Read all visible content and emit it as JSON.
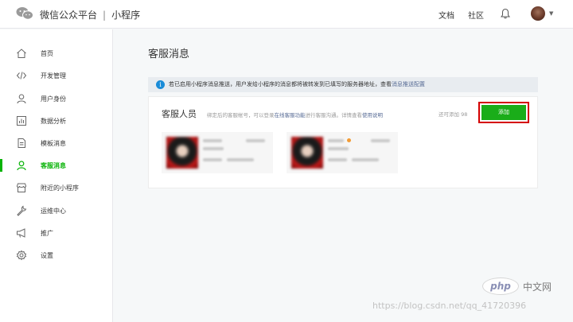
{
  "header": {
    "brand": "微信公众平台",
    "separator": "|",
    "product": "小程序",
    "nav": [
      "文档",
      "社区"
    ],
    "icons": {
      "logo": "wechat-logo-icon",
      "notifications": "bell-icon",
      "account_caret": "chevron-down-icon"
    }
  },
  "sidebar": {
    "items": [
      {
        "label": "首页",
        "icon": "home-icon"
      },
      {
        "label": "开发管理",
        "icon": "code-icon"
      },
      {
        "label": "用户身份",
        "icon": "user-icon"
      },
      {
        "label": "数据分析",
        "icon": "bar-chart-icon"
      },
      {
        "label": "模板消息",
        "icon": "document-icon"
      },
      {
        "label": "客服消息",
        "icon": "customer-service-icon",
        "active": true
      },
      {
        "label": "附近的小程序",
        "icon": "store-icon"
      },
      {
        "label": "运维中心",
        "icon": "wrench-icon"
      },
      {
        "label": "推广",
        "icon": "megaphone-icon"
      },
      {
        "label": "设置",
        "icon": "gear-icon"
      }
    ]
  },
  "main": {
    "title": "客服消息",
    "notice": {
      "text": "若已启用小程序消息推送，用户发给小程序的消息都将被转发到已填写的服务器地址，查看",
      "link": "消息推送配置"
    },
    "card": {
      "title": "客服人员",
      "desc_prefix": "绑定后的客服帐号，可以登录",
      "desc_link": "在线客服功能",
      "desc_mid": "进行客服沟通。详情查看",
      "desc_link2": "使用说明",
      "remaining": "还可添加 98",
      "add_button": "添加"
    }
  },
  "watermark": {
    "php": "php",
    "cn": "中文网",
    "url": "https://blog.csdn.net/qq_41720396"
  },
  "colors": {
    "accent": "#1aad19",
    "active_nav": "#07b306",
    "link": "#576b95",
    "highlight_border": "#d40000",
    "info": "#1a8cd8"
  }
}
